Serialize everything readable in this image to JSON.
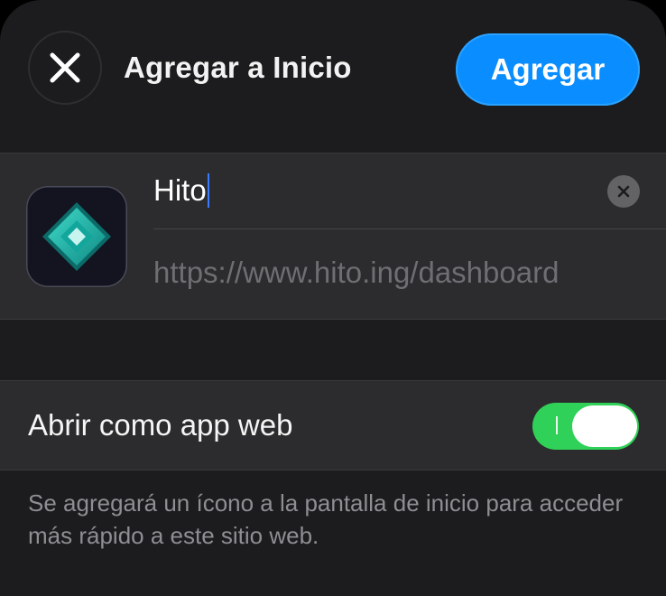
{
  "header": {
    "title": "Agregar a Inicio",
    "add_label": "Agregar",
    "close_icon": "close-icon"
  },
  "site": {
    "name_value": "Hito",
    "url": "https://www.hito.ing/dashboard",
    "icon": "hito-logo-icon",
    "clear_icon": "clear-icon"
  },
  "settings": {
    "web_app_label": "Abrir como app web",
    "web_app_enabled": true
  },
  "footnote": "Se agregará un ícono a la pantalla de inicio para acceder más rápido a este sitio web.",
  "colors": {
    "accent": "#0a8dff",
    "toggle_on": "#30d158",
    "sheet_bg": "#1c1c1e",
    "card_bg": "#2c2c2e"
  }
}
